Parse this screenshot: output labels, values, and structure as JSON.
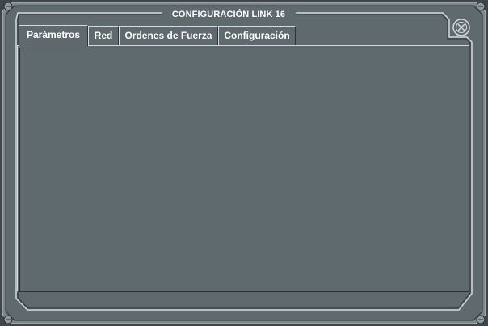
{
  "window": {
    "title": "CONFIGURACIÓN LINK 16"
  },
  "tabs": [
    {
      "label": "Parámetros",
      "active": true
    },
    {
      "label": "Red",
      "active": false
    },
    {
      "label": "Ordenes de Fuerza",
      "active": false
    },
    {
      "label": "Configuración",
      "active": false
    }
  ],
  "icons": {
    "close": "close-x-icon",
    "corner_rivet": "rivet-icon"
  },
  "colors": {
    "panel": "#5f6a6e",
    "bevel_light": "#d4d9db",
    "bevel_dark": "#2a3032",
    "text": "#ffffff"
  }
}
